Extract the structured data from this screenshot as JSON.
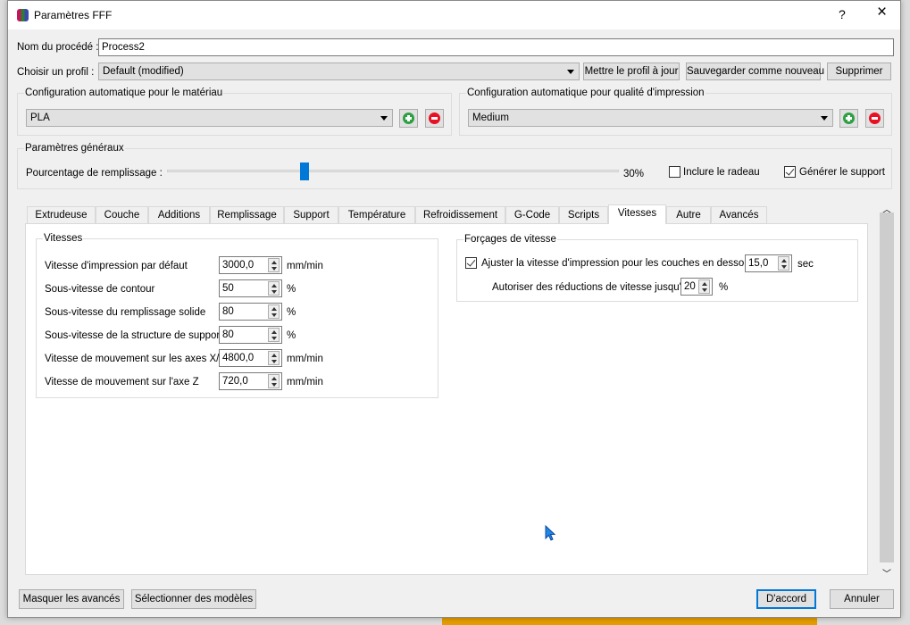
{
  "window": {
    "title": "Paramètres FFF",
    "help": "?",
    "close": "×"
  },
  "process_name": {
    "label": "Nom du procédé :",
    "value": "Process2"
  },
  "profile": {
    "label": "Choisir un profil :",
    "value": "Default (modified)",
    "update_button": "Mettre le profil à jour",
    "save_new_button": "Sauvegarder comme nouveau",
    "delete_button": "Supprimer"
  },
  "material": {
    "title": "Configuration automatique pour le matériau",
    "value": "PLA"
  },
  "quality": {
    "title": "Configuration automatique pour qualité d'impression",
    "value": "Medium"
  },
  "general": {
    "title": "Paramètres généraux",
    "infill_label": "Pourcentage de remplissage :",
    "infill_percent": 30,
    "infill_text": "30%",
    "raft_label": "Inclure le radeau",
    "raft_checked": false,
    "support_label": "Générer le support",
    "support_checked": true
  },
  "tabs": [
    "Extrudeuse",
    "Couche",
    "Additions",
    "Remplissage",
    "Support",
    "Température",
    "Refroidissement",
    "G-Code",
    "Scripts",
    "Vitesses",
    "Autre",
    "Avancés"
  ],
  "selected_tab": "Vitesses",
  "speeds": {
    "title": "Vitesses",
    "rows": [
      {
        "label": "Vitesse d'impression par défaut",
        "value": "3000,0",
        "unit": "mm/min"
      },
      {
        "label": "Sous-vitesse de contour",
        "value": "50",
        "unit": "%"
      },
      {
        "label": "Sous-vitesse du remplissage solide",
        "value": "80",
        "unit": "%"
      },
      {
        "label": "Sous-vitesse de la structure de support",
        "value": "80",
        "unit": "%"
      },
      {
        "label": "Vitesse de mouvement sur les axes X/Y",
        "value": "4800,0",
        "unit": "mm/min"
      },
      {
        "label": "Vitesse de mouvement sur l'axe Z",
        "value": "720,0",
        "unit": "mm/min"
      }
    ]
  },
  "overrides": {
    "title": "Forçages de vitesse",
    "adjust_label": "Ajuster la vitesse d'impression pour les couches en dessous",
    "adjust_checked": true,
    "adjust_value": "15,0",
    "adjust_unit": "sec",
    "reduce_label": "Autoriser des réductions de vitesse jusqu'à",
    "reduce_value": "20",
    "reduce_unit": "%"
  },
  "footer": {
    "hide_advanced": "Masquer les avancés",
    "select_models": "Sélectionner des modèles",
    "ok": "D'accord",
    "cancel": "Annuler"
  },
  "colors": {
    "accent": "#0078d7",
    "add": "#2ea043",
    "remove": "#e81123"
  }
}
